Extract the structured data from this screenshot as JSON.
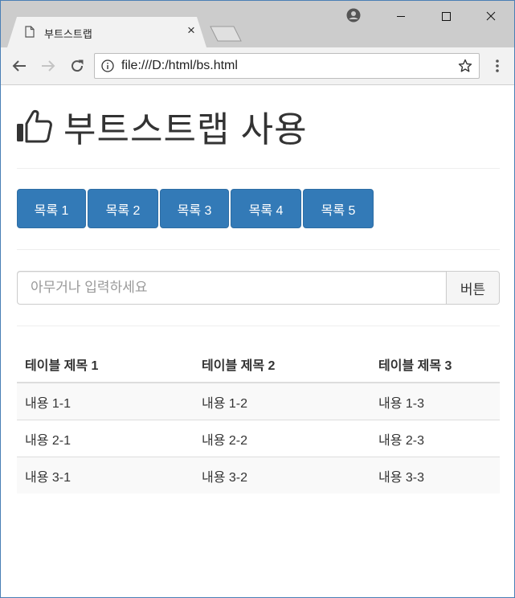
{
  "browser": {
    "tab_title": "부트스트랩",
    "tab_close": "×",
    "url": "file:///D:/html/bs.html"
  },
  "page": {
    "title": "부트스트랩 사용",
    "buttons": [
      "목록 1",
      "목록 2",
      "목록 3",
      "목록 4",
      "목록 5"
    ],
    "search": {
      "placeholder": "아무거나 입력하세요",
      "value": "",
      "button_label": "버튼"
    },
    "table": {
      "headers": [
        "테이블 제목 1",
        "테이블 제목 2",
        "테이블 제목 3"
      ],
      "rows": [
        [
          "내용 1-1",
          "내용 1-2",
          "내용 1-3"
        ],
        [
          "내용 2-1",
          "내용 2-2",
          "내용 2-3"
        ],
        [
          "내용 3-1",
          "내용 3-2",
          "내용 3-3"
        ]
      ]
    }
  },
  "colors": {
    "primary": "#337ab7",
    "primary_border": "#2e6da4",
    "text": "#333333",
    "striped_row": "#f9f9f9"
  },
  "icons": {
    "heading": "thumbs-up-icon",
    "tab": "document-icon",
    "omnibox_left": "info-icon",
    "omnibox_right": "star-icon"
  }
}
